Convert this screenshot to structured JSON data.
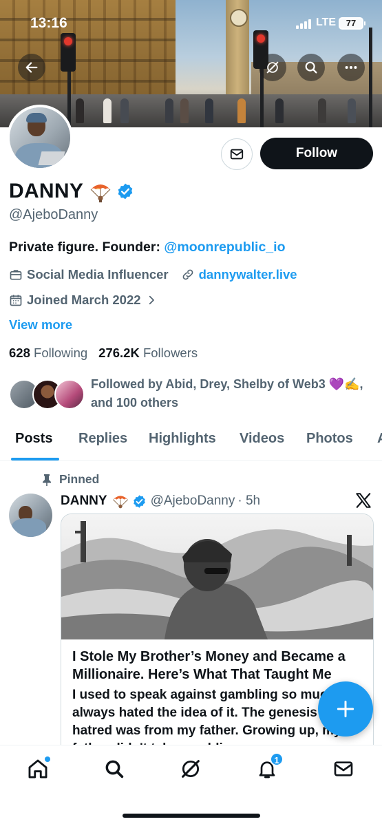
{
  "status_bar": {
    "time": "13:16",
    "network": "LTE",
    "battery": "77"
  },
  "header": {
    "icons": [
      "back-arrow-icon",
      "grok-icon",
      "search-icon",
      "more-icon"
    ]
  },
  "profile": {
    "name": "DANNY",
    "name_emoji": "parachute",
    "verified": true,
    "handle": "@AjeboDanny",
    "bio_text": "Private figure. Founder: ",
    "bio_mention": "@moonrepublic_io",
    "category": "Social Media Influencer",
    "website": "dannywalter.live",
    "joined": "Joined March 2022",
    "view_more": "View more",
    "following_count": "628",
    "following_label": "Following",
    "followers_count": "276.2K",
    "followers_label": "Followers",
    "followed_by": "Followed by Abid, Drey, Shelby of Web3 💜✍️, and 100 others"
  },
  "actions": {
    "follow_label": "Follow"
  },
  "tabs": [
    {
      "label": "Posts",
      "active": true
    },
    {
      "label": "Replies",
      "active": false
    },
    {
      "label": "Highlights",
      "active": false
    },
    {
      "label": "Videos",
      "active": false
    },
    {
      "label": "Photos",
      "active": false
    }
  ],
  "post": {
    "pinned_label": "Pinned",
    "author_name": "DANNY",
    "author_handle": "@AjeboDanny",
    "time": "· 5h",
    "card_title": "I Stole My Brother’s Money and Became a Millionaire. Here’s What That Taught Me",
    "card_body": "I used to speak against gambling so much, I've always hated the idea of it. The genesis of this hatred was from my father. Growing up, my father didn't take gambling or"
  },
  "bottom_nav": {
    "items": [
      "home-icon",
      "search-icon",
      "grok-icon",
      "notifications-icon",
      "messages-icon"
    ],
    "notifications_badge": "1"
  },
  "colors": {
    "accent": "#1d9bf0",
    "text": "#0f1419",
    "muted": "#536471",
    "follow_button": "#0f1419"
  }
}
